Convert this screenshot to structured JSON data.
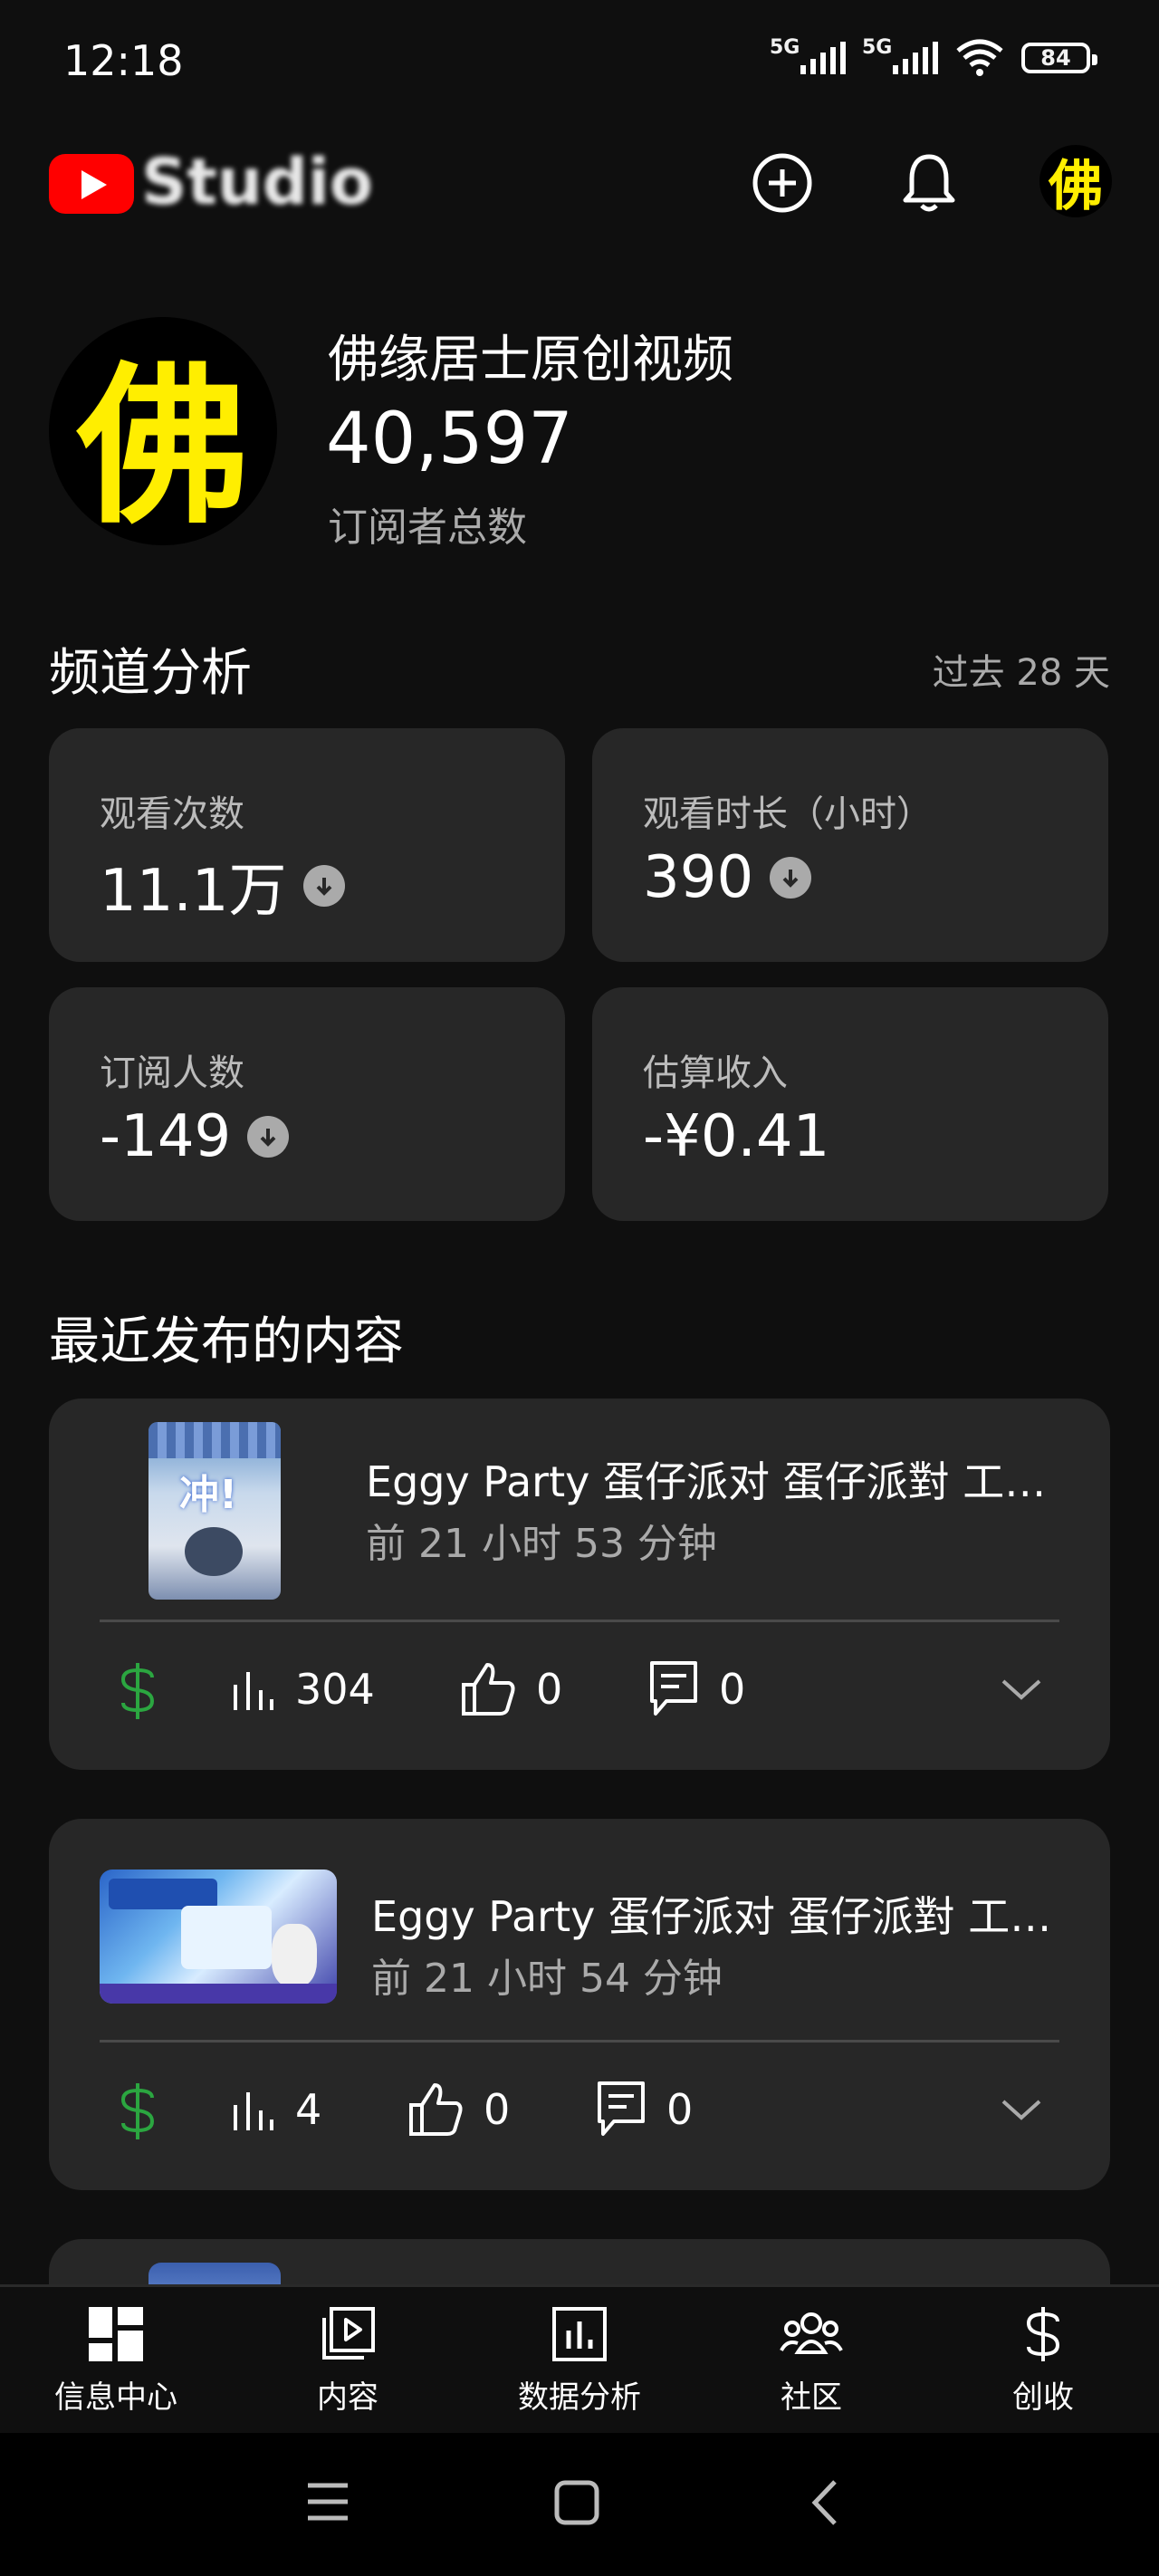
{
  "status_bar": {
    "time": "12:18",
    "signal1_label": "5G",
    "signal2_label": "5G",
    "battery": "84"
  },
  "header": {
    "logo_text": "Studio",
    "avatar_char": "佛"
  },
  "channel": {
    "name": "佛缘居士原创视频",
    "subscriber_count": "40,597",
    "subscriber_label": "订阅者总数",
    "avatar_char": "佛"
  },
  "analytics": {
    "title": "频道分析",
    "period": "过去 28 天",
    "cards": [
      {
        "label": "观看次数",
        "value": "11.1万"
      },
      {
        "label": "观看时长（小时）",
        "value": "390"
      },
      {
        "label": "订阅人数",
        "value": "-149"
      },
      {
        "label": "估算收入",
        "value": "-¥0.41"
      }
    ]
  },
  "recent": {
    "title": "最近发布的内容",
    "videos": [
      {
        "title": "Eggy Party 蛋仔派对 蛋仔派對 工…",
        "time": "前 21 小时 53 分钟",
        "views": "304",
        "likes": "0",
        "comments": "0",
        "thumb_text": "冲!"
      },
      {
        "title": "Eggy Party 蛋仔派对 蛋仔派對 工…",
        "time": "前 21 小时 54 分钟",
        "views": "4",
        "likes": "0",
        "comments": "0"
      }
    ]
  },
  "bottom_nav": [
    {
      "label": "信息中心"
    },
    {
      "label": "内容"
    },
    {
      "label": "数据分析"
    },
    {
      "label": "社区"
    },
    {
      "label": "创收"
    }
  ],
  "colors": {
    "background": "#0f0f0f",
    "card": "#272727",
    "brand_red": "#ff0000",
    "monetize_green": "#2ba640",
    "avatar_yellow": "#ffee00"
  }
}
